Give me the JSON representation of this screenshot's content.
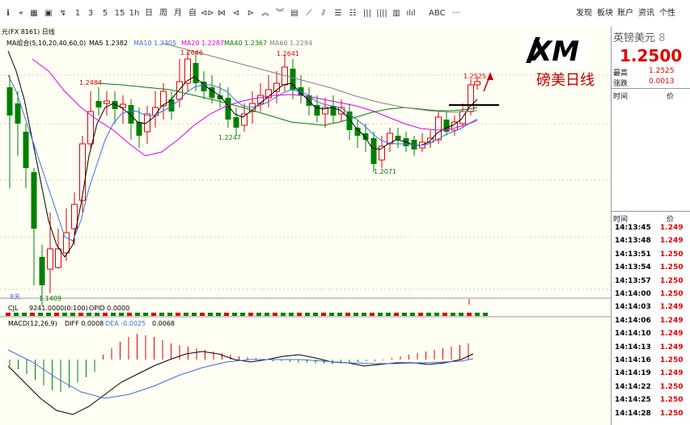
{
  "toolbar": {
    "buttons": [
      {
        "icon": "pin-icon",
        "label": "ℹ"
      },
      {
        "icon": "crosshair-icon",
        "label": "⌖"
      },
      {
        "icon": "grid-icon",
        "label": "▦"
      },
      {
        "icon": "save-icon",
        "label": "▣"
      },
      {
        "icon": "draw-icon",
        "label": "↯"
      },
      {
        "icon": "period-1",
        "label": "1"
      },
      {
        "icon": "period-3",
        "label": "3"
      },
      {
        "icon": "period-5",
        "label": "5"
      },
      {
        "icon": "period-15",
        "label": "15"
      },
      {
        "icon": "period-1h",
        "label": "1h"
      },
      {
        "icon": "period-day",
        "label": "日"
      },
      {
        "icon": "period-week",
        "label": "周"
      },
      {
        "icon": "period-month",
        "label": "月"
      },
      {
        "icon": "period-custom",
        "label": "自"
      },
      {
        "icon": "zoom-in-icon",
        "label": "⊲⊳"
      },
      {
        "icon": "zoom-out-icon",
        "label": "⋈"
      },
      {
        "icon": "left-arrow-icon",
        "label": "⊲"
      },
      {
        "icon": "right-arrow-icon",
        "label": "⊳"
      },
      {
        "icon": "up-icon",
        "label": "︽"
      },
      {
        "icon": "down-icon",
        "label": "︾"
      },
      {
        "icon": "chart-type-icon",
        "label": "▤"
      },
      {
        "icon": "line-icon",
        "label": "⟋"
      },
      {
        "icon": "channel-icon",
        "label": "⫽"
      },
      {
        "icon": "fib-icon",
        "label": "☰"
      },
      {
        "icon": "gann-icon",
        "label": "☷"
      },
      {
        "icon": "bars-icon",
        "label": "|||"
      },
      {
        "icon": "bars2-icon",
        "label": "||||"
      },
      {
        "icon": "bars3-icon",
        "label": "▥"
      },
      {
        "icon": "volume-icon",
        "label": "ılıl"
      },
      {
        "icon": "abc-icon",
        "label": "ABC"
      },
      {
        "icon": "more-icon",
        "label": "···"
      }
    ],
    "right": [
      "发现",
      "板块",
      "账户",
      "资讯",
      "个性"
    ]
  },
  "chart": {
    "symbol_label": "元(FX 8161)  日线",
    "ma_legend": {
      "title": "MA组合(5,10,20,40,60,0)",
      "ma5": "MA5 1.2382",
      "ma10": "MA10 1.2305",
      "ma20": "MA20 1.2287",
      "ma40": "MA40 1.2367",
      "ma60": "MA60 1.2294"
    },
    "price_labels": {
      "p2646": "1.2646",
      "p2641": "1.2641",
      "p2484": "1.2484",
      "p2525": "1.2525",
      "p2247": "1.2247",
      "p2071": "1.2071",
      "p1409": "1.1409"
    },
    "days_label": "8天",
    "vol_legend": {
      "cjl": "CJL",
      "val": "9241.0000(0:100)",
      "opid": "OPID 0.0000"
    },
    "macd_legend": {
      "title": "MACD(12,26,9)",
      "diff": "DIFF 0.0008",
      "dea": "DEA -0.0025",
      "macd": "0.0068"
    },
    "colors": {
      "up": "#e00000",
      "down": "#008000",
      "ma5": "#000000",
      "ma10": "#3c6fe0",
      "ma20": "#e000e0",
      "ma40": "#008000",
      "ma60": "#808080"
    }
  },
  "watermark": {
    "caption": "磅美日线"
  },
  "right_panel": {
    "name": "英镑美元",
    "name_suffix": "8",
    "price": "1.2500",
    "high_label": "最高",
    "high_value": "1.2525",
    "change_label": "涨跌",
    "change_value": "0.0013",
    "time_label": "时间",
    "price_label": "价",
    "tick_header_time": "时间",
    "tick_header_price": "价",
    "ticks": [
      {
        "time": "14:13:45",
        "price": "1.249"
      },
      {
        "time": "14:13:48",
        "price": "1.249"
      },
      {
        "time": "14:13:51",
        "price": "1.250"
      },
      {
        "time": "14:13:54",
        "price": "1.250"
      },
      {
        "time": "14:13:57",
        "price": "1.250"
      },
      {
        "time": "14:14:00",
        "price": "1.250"
      },
      {
        "time": "14:14:03",
        "price": "1.249"
      },
      {
        "time": "14:14:06",
        "price": "1.249"
      },
      {
        "time": "14:14:10",
        "price": "1.249"
      },
      {
        "time": "14:14:13",
        "price": "1.249"
      },
      {
        "time": "14:14:16",
        "price": "1.250"
      },
      {
        "time": "14:14:19",
        "price": "1.249"
      },
      {
        "time": "14:14:22",
        "price": "1.250"
      },
      {
        "time": "14:14:25",
        "price": "1.250"
      },
      {
        "time": "14:14:28",
        "price": "1.250"
      }
    ]
  }
}
